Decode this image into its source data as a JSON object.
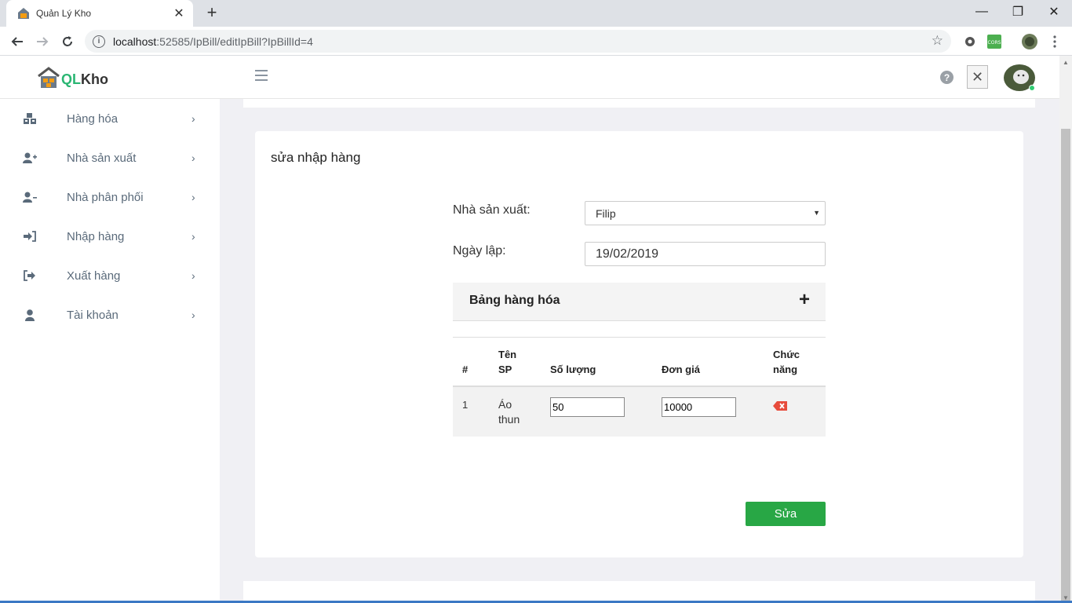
{
  "browser": {
    "tab_title": "Quản Lý Kho",
    "url_host": "localhost",
    "url_rest": ":52585/IpBill/editIpBill?IpBillId=4",
    "ext_cors_label": "CORS"
  },
  "app": {
    "logo_ql": "QL",
    "logo_kho": "Kho"
  },
  "sidebar": {
    "items": [
      {
        "label": "Hàng hóa",
        "icon": "boxes-icon"
      },
      {
        "label": "Nhà sản xuất",
        "icon": "user-plus-icon"
      },
      {
        "label": "Nhà phân phối",
        "icon": "user-minus-icon"
      },
      {
        "label": "Nhập hàng",
        "icon": "sign-in-icon"
      },
      {
        "label": "Xuất hàng",
        "icon": "sign-out-icon"
      },
      {
        "label": "Tài khoản",
        "icon": "user-icon"
      }
    ]
  },
  "form": {
    "title": "sửa nhập hàng",
    "manufacturer_label": "Nhà sản xuất:",
    "manufacturer_value": "Filip",
    "date_label": "Ngày lập:",
    "date_value": "19/02/2019",
    "table_title": "Bảng hàng hóa",
    "add_symbol": "+",
    "columns": {
      "index": "#",
      "name_l1": "Tên",
      "name_l2": "SP",
      "qty": "Số lượng",
      "price": "Đơn giá",
      "action_l1": "Chức",
      "action_l2": "năng"
    },
    "rows": [
      {
        "index": "1",
        "name_l1": "Áo",
        "name_l2": "thun",
        "qty": "50",
        "price": "10000"
      }
    ],
    "submit_label": "Sửa"
  },
  "colors": {
    "accent": "#28a745",
    "delete": "#e74c3c",
    "logo_green": "#2bb673"
  }
}
